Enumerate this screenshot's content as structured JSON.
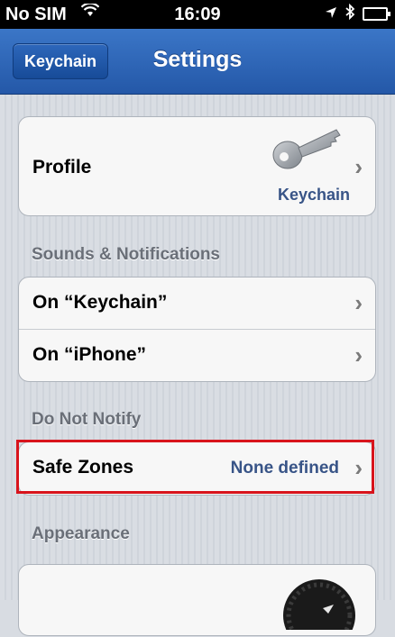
{
  "status_bar": {
    "carrier": "No SIM",
    "time": "16:09"
  },
  "nav": {
    "back_label": "Keychain",
    "title": "Settings"
  },
  "profile": {
    "label": "Profile",
    "subtitle": "Keychain"
  },
  "sections": {
    "sounds_header": "Sounds & Notifications",
    "do_not_notify_header": "Do Not Notify",
    "appearance_header": "Appearance"
  },
  "sounds": {
    "on_keychain": "On “Keychain”",
    "on_iphone": "On “iPhone”"
  },
  "safe_zones": {
    "label": "Safe Zones",
    "value": "None defined"
  },
  "icons": [
    "wifi-icon",
    "location-icon",
    "bluetooth-icon",
    "battery-icon",
    "key-icon",
    "chevron-right-icon"
  ],
  "colors": {
    "nav_blue": "#2d67bb",
    "detail_blue": "#385487",
    "highlight_red": "#d8141c"
  }
}
